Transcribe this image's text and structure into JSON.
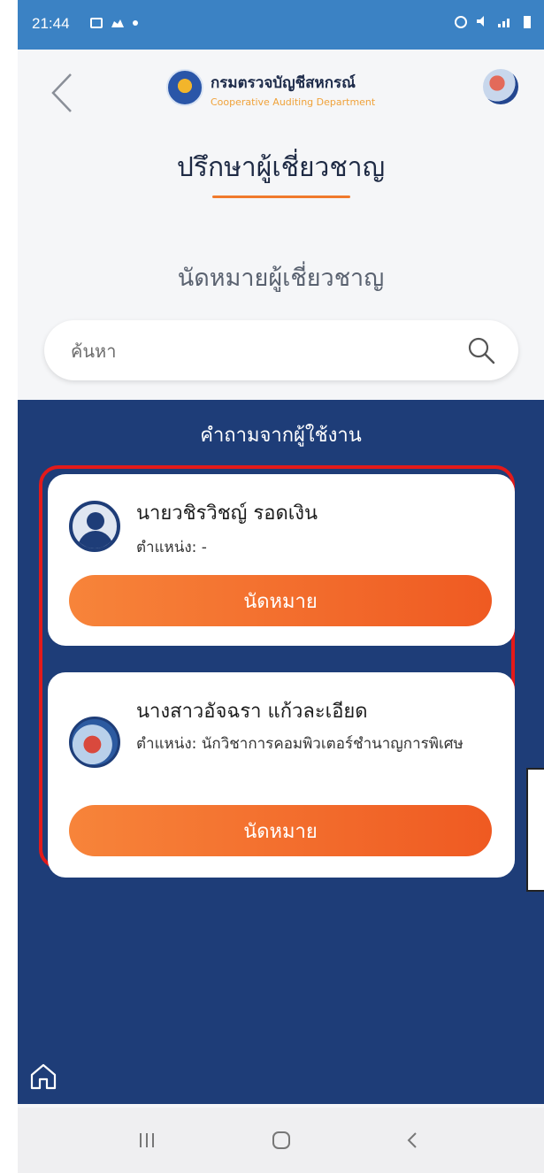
{
  "status_bar": {
    "time": "21:44"
  },
  "header": {
    "brand_th": "กรมตรวจบัญชีสหกรณ์",
    "brand_en": "Cooperative Auditing Department",
    "title": "ปรึกษาผู้เชี่ยวชาญ"
  },
  "section": {
    "subtitle": "นัดหมายผู้เชี่ยวชาญ"
  },
  "search": {
    "placeholder": "ค้นหา",
    "value": ""
  },
  "panel": {
    "title": "คำถามจากผู้ใช้งาน",
    "experts": [
      {
        "name": "นายวชิรวิชญ์ รอดเงิน",
        "position_label": "ตำแหน่ง: -",
        "button": "นัดหมาย"
      },
      {
        "name": "นางสาวอัจฉรา แก้วละเอียด",
        "position_label": "ตำแหน่ง: นักวิชาการคอมพิวเตอร์ชำนาญการพิเศษ",
        "button": "นัดหมาย"
      }
    ]
  },
  "colors": {
    "status_bar": "#3b82c4",
    "panel": "#1e3d78",
    "accent_orange": "#f07a2c",
    "highlight": "#e31a1a"
  },
  "icons": [
    "back-icon",
    "logo-icon",
    "avatar",
    "search-icon",
    "person-icon",
    "home-icon",
    "recent-apps-icon",
    "home-button-icon",
    "back-nav-icon"
  ]
}
